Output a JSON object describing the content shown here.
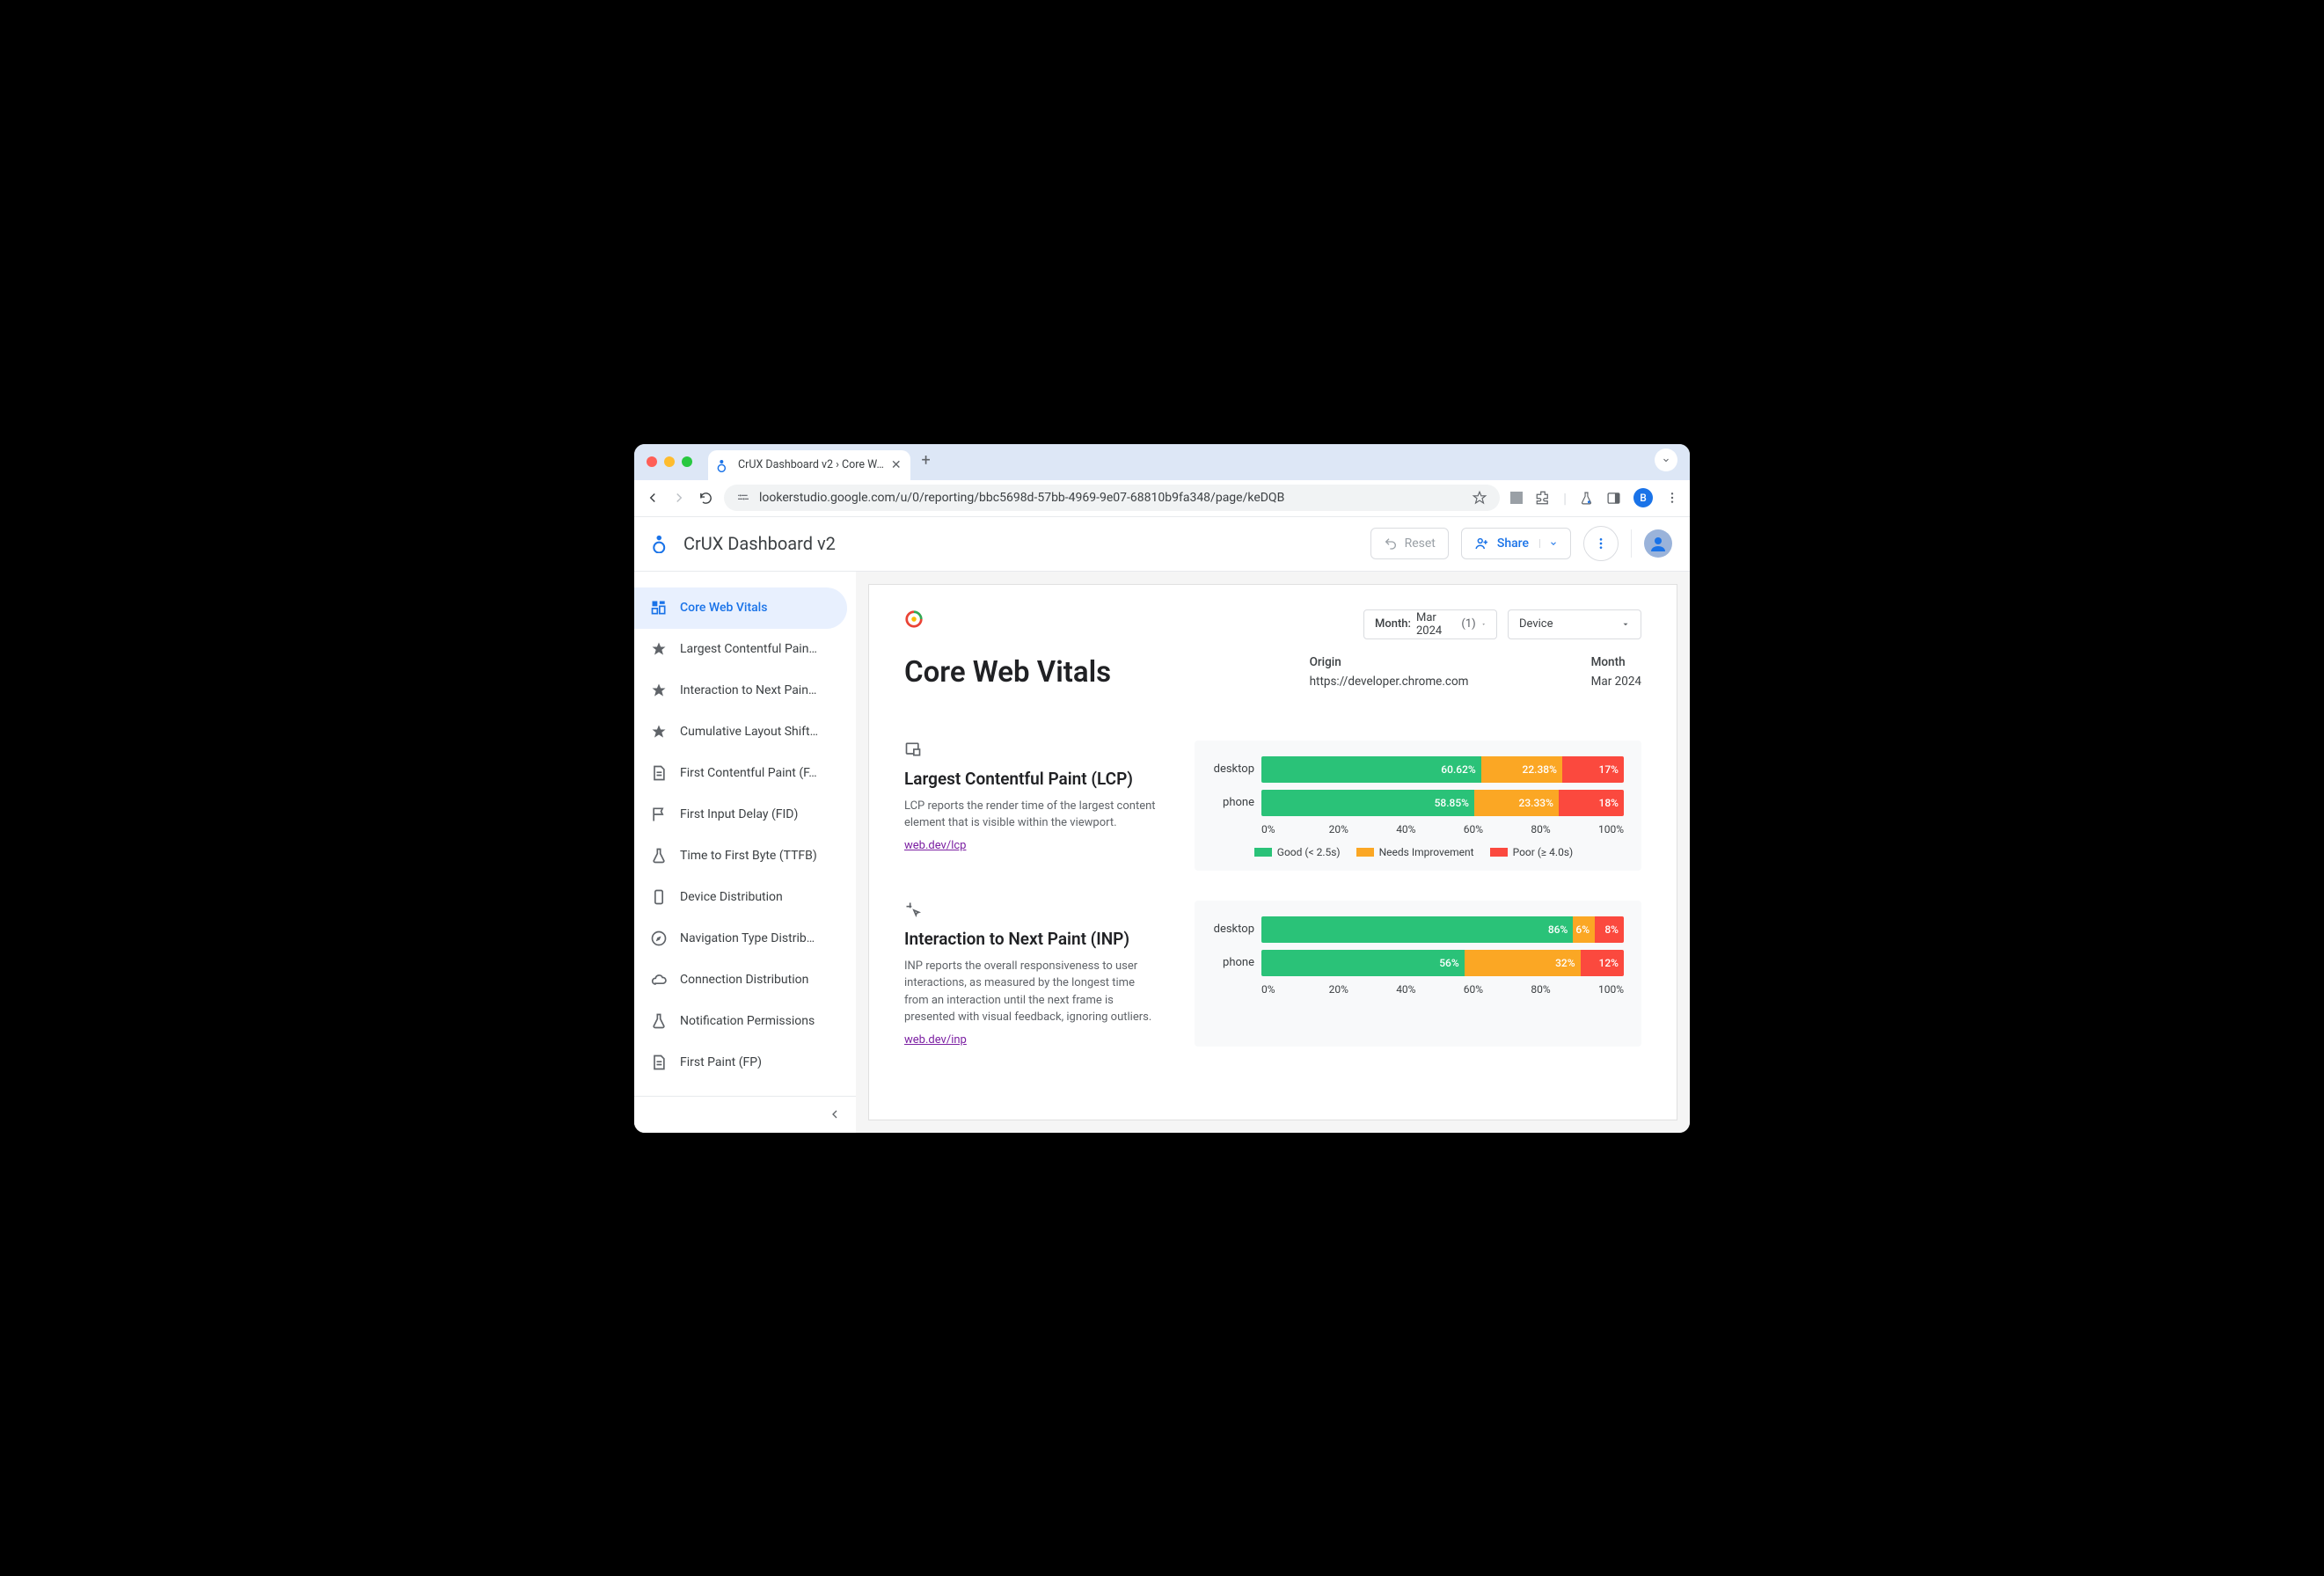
{
  "browser": {
    "tab_title": "CrUX Dashboard v2 › Core W…",
    "url": "lookerstudio.google.com/u/0/reporting/bbc5698d-57bb-4969-9e07-68810b9fa348/page/keDQB",
    "avatar_letter": "B"
  },
  "header": {
    "title": "CrUX Dashboard v2",
    "reset": "Reset",
    "share": "Share"
  },
  "sidebar": {
    "items": [
      {
        "label": "Core Web Vitals",
        "icon": "dashboard",
        "active": true
      },
      {
        "label": "Largest Contentful Pain…",
        "icon": "star"
      },
      {
        "label": "Interaction to Next Pain…",
        "icon": "star"
      },
      {
        "label": "Cumulative Layout Shift…",
        "icon": "star"
      },
      {
        "label": "First Contentful Paint (F…",
        "icon": "doc"
      },
      {
        "label": "First Input Delay (FID)",
        "icon": "flag"
      },
      {
        "label": "Time to First Byte (TTFB)",
        "icon": "flask"
      },
      {
        "label": "Device Distribution",
        "icon": "device"
      },
      {
        "label": "Navigation Type Distrib…",
        "icon": "compass"
      },
      {
        "label": "Connection Distribution",
        "icon": "cloud"
      },
      {
        "label": "Notification Permissions",
        "icon": "flask"
      },
      {
        "label": "First Paint (FP)",
        "icon": "doc"
      }
    ]
  },
  "filters": {
    "month_label": "Month:",
    "month_value": "Mar 2024",
    "month_count": "(1)",
    "device_label": "Device"
  },
  "report": {
    "title": "Core Web Vitals",
    "origin_label": "Origin",
    "origin_value": "https://developer.chrome.com",
    "month_label": "Month",
    "month_value": "Mar 2024"
  },
  "metrics": [
    {
      "title": "Largest Contentful Paint (LCP)",
      "desc": "LCP reports the render time of the largest content element that is visible within the viewport.",
      "link": "web.dev/lcp",
      "legend": {
        "good": "Good (< 2.5s)",
        "ni": "Needs Improvement",
        "poor": "Poor (≥ 4.0s)"
      }
    },
    {
      "title": "Interaction to Next Paint (INP)",
      "desc": "INP reports the overall responsiveness to user interactions, as measured by the longest time from an interaction until the next frame is presented with visual feedback, ignoring outliers.",
      "link": "web.dev/inp"
    }
  ],
  "axis": [
    "0%",
    "20%",
    "40%",
    "60%",
    "80%",
    "100%"
  ],
  "chart_data": [
    {
      "type": "bar",
      "title": "Largest Contentful Paint (LCP)",
      "categories": [
        "desktop",
        "phone"
      ],
      "series": [
        {
          "name": "Good (< 2.5s)",
          "values": [
            60.62,
            58.85
          ],
          "labels": [
            "60.62%",
            "58.85%"
          ],
          "color": "#2ac278"
        },
        {
          "name": "Needs Improvement",
          "values": [
            22.38,
            23.33
          ],
          "labels": [
            "22.38%",
            "23.33%"
          ],
          "color": "#fba724"
        },
        {
          "name": "Poor (≥ 4.0s)",
          "values": [
            17,
            18
          ],
          "labels": [
            "17%",
            "18%"
          ],
          "color": "#fb493e"
        }
      ],
      "xlabel": "",
      "ylabel": "",
      "ylim": [
        0,
        100
      ]
    },
    {
      "type": "bar",
      "title": "Interaction to Next Paint (INP)",
      "categories": [
        "desktop",
        "phone"
      ],
      "series": [
        {
          "name": "Good",
          "values": [
            86,
            56
          ],
          "labels": [
            "86%",
            "56%"
          ],
          "color": "#2ac278"
        },
        {
          "name": "Needs Improvement",
          "values": [
            6,
            32
          ],
          "labels": [
            "6%",
            "32%"
          ],
          "color": "#fba724"
        },
        {
          "name": "Poor",
          "values": [
            8,
            12
          ],
          "labels": [
            "8%",
            "12%"
          ],
          "color": "#fb493e"
        }
      ],
      "xlabel": "",
      "ylabel": "",
      "ylim": [
        0,
        100
      ]
    }
  ]
}
